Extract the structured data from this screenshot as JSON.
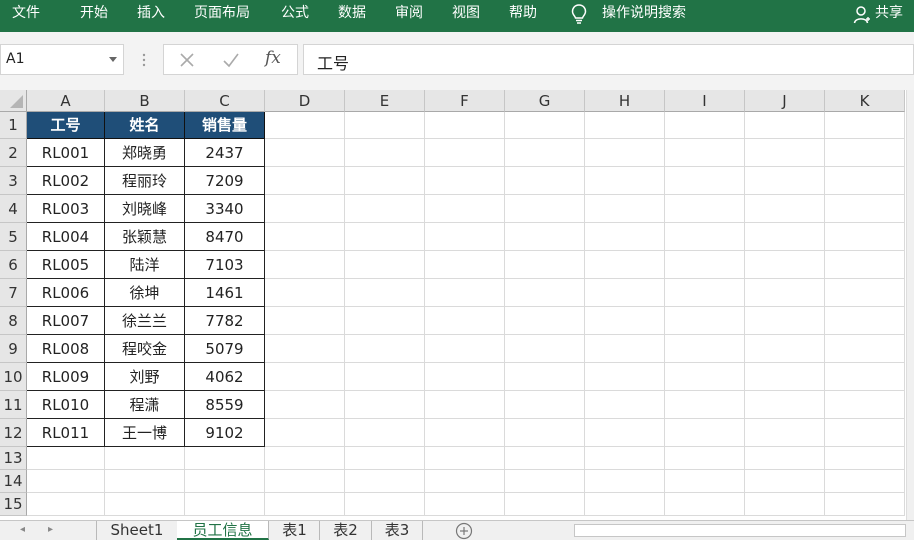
{
  "ribbon": {
    "tabs": [
      "文件",
      "开始",
      "插入",
      "页面布局",
      "公式",
      "数据",
      "审阅",
      "视图",
      "帮助"
    ],
    "search_label": "操作说明搜索",
    "share_label": "共享",
    "color": "#217346"
  },
  "formula_bar": {
    "name_box": "A1",
    "formula": "工号",
    "fx_label": "fx"
  },
  "columns": [
    "A",
    "B",
    "C",
    "D",
    "E",
    "F",
    "G",
    "H",
    "I",
    "J",
    "K"
  ],
  "rows": [
    "1",
    "2",
    "3",
    "4",
    "5",
    "6",
    "7",
    "8",
    "9",
    "10",
    "11",
    "12",
    "13",
    "14",
    "15"
  ],
  "table": {
    "headers": [
      "工号",
      "姓名",
      "销售量"
    ],
    "header_color": "#1f4e78",
    "rows": [
      [
        "RL001",
        "郑晓勇",
        "2437"
      ],
      [
        "RL002",
        "程丽玲",
        "7209"
      ],
      [
        "RL003",
        "刘晓峰",
        "3340"
      ],
      [
        "RL004",
        "张颖慧",
        "8470"
      ],
      [
        "RL005",
        "陆洋",
        "7103"
      ],
      [
        "RL006",
        "徐坤",
        "1461"
      ],
      [
        "RL007",
        "徐兰兰",
        "7782"
      ],
      [
        "RL008",
        "程咬金",
        "5079"
      ],
      [
        "RL009",
        "刘野",
        "4062"
      ],
      [
        "RL010",
        "程潇",
        "8559"
      ],
      [
        "RL011",
        "王一博",
        "9102"
      ]
    ]
  },
  "sheets": {
    "tabs": [
      "Sheet1",
      "员工信息",
      "表1",
      "表2",
      "表3"
    ],
    "active": "员工信息",
    "nav_prev": "◂",
    "nav_next": "▸"
  }
}
